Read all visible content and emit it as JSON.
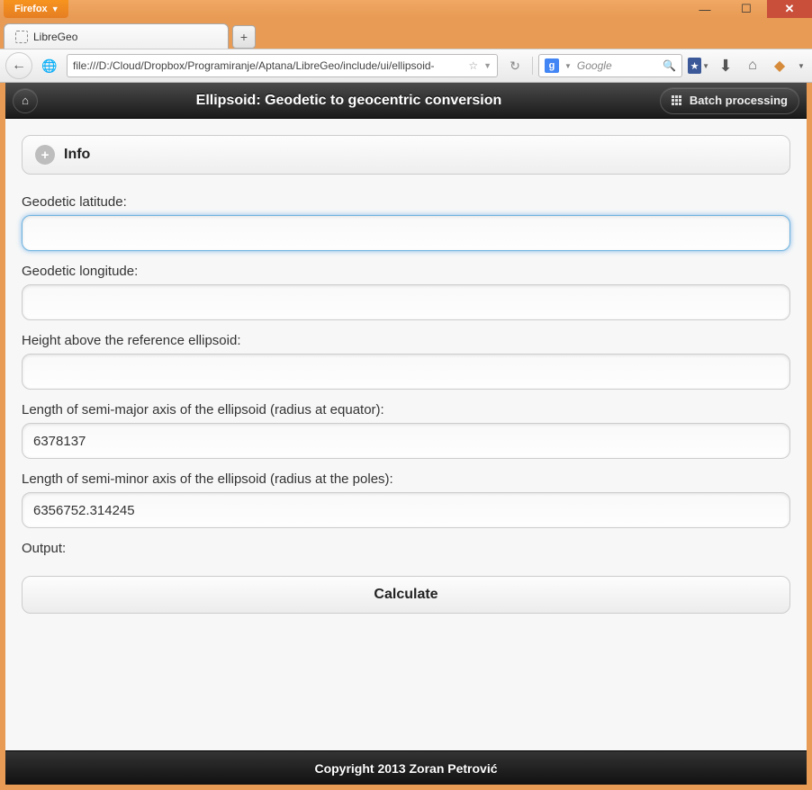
{
  "browser": {
    "name": "Firefox",
    "tab_title": "LibreGeo",
    "url": "file:///D:/Cloud/Dropbox/Programiranje/Aptana/LibreGeo/include/ui/ellipsoid-",
    "search_placeholder": "Google"
  },
  "app": {
    "title": "Ellipsoid: Geodetic to geocentric conversion",
    "batch_button": "Batch processing",
    "info_header": "Info",
    "fields": {
      "lat_label": "Geodetic latitude:",
      "lat_value": "",
      "lon_label": "Geodetic longitude:",
      "lon_value": "",
      "height_label": "Height above the reference ellipsoid:",
      "height_value": "",
      "semi_major_label": "Length of semi-major axis of the ellipsoid (radius at equator):",
      "semi_major_value": "6378137",
      "semi_minor_label": "Length of semi-minor axis of the ellipsoid (radius at the poles):",
      "semi_minor_value": "6356752.314245",
      "output_label": "Output:"
    },
    "calculate_button": "Calculate",
    "footer": "Copyright 2013 Zoran Petrović"
  }
}
